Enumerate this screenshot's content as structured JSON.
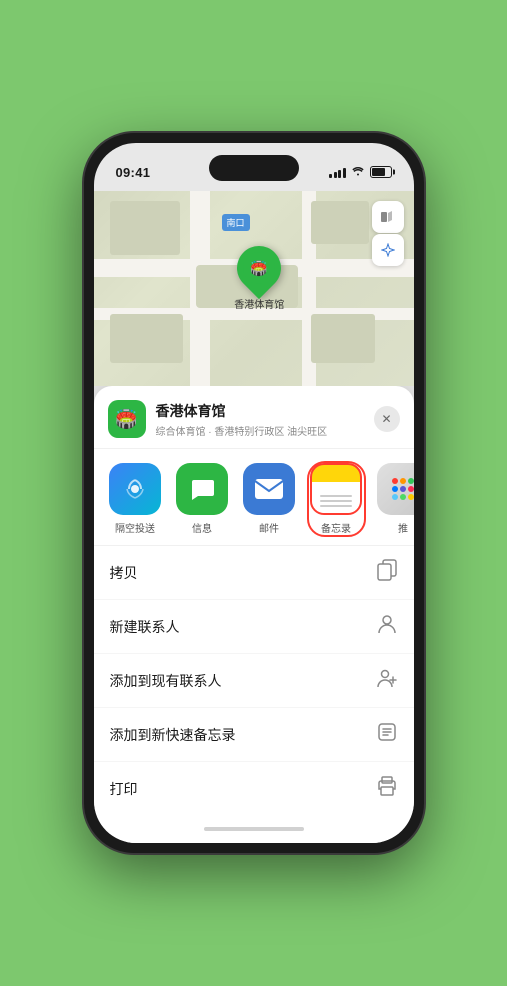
{
  "statusBar": {
    "time": "09:41",
    "locationIcon": "▶"
  },
  "map": {
    "label": "南口",
    "pin": {
      "label": "香港体育馆"
    }
  },
  "sheet": {
    "venueName": "香港体育馆",
    "venueDesc": "综合体育馆 · 香港特别行政区 油尖旺区",
    "closeLabel": "✕"
  },
  "shareItems": [
    {
      "id": "airdrop",
      "label": "隔空投送",
      "icon": "📡"
    },
    {
      "id": "message",
      "label": "信息",
      "icon": "💬"
    },
    {
      "id": "mail",
      "label": "邮件",
      "icon": "✉"
    },
    {
      "id": "notes",
      "label": "备忘录",
      "icon": "📝"
    },
    {
      "id": "more",
      "label": "推",
      "icon": "···"
    }
  ],
  "actions": [
    {
      "label": "拷贝",
      "icon": "copy"
    },
    {
      "label": "新建联系人",
      "icon": "person"
    },
    {
      "label": "添加到现有联系人",
      "icon": "person-add"
    },
    {
      "label": "添加到新快速备忘录",
      "icon": "memo"
    },
    {
      "label": "打印",
      "icon": "print"
    }
  ]
}
